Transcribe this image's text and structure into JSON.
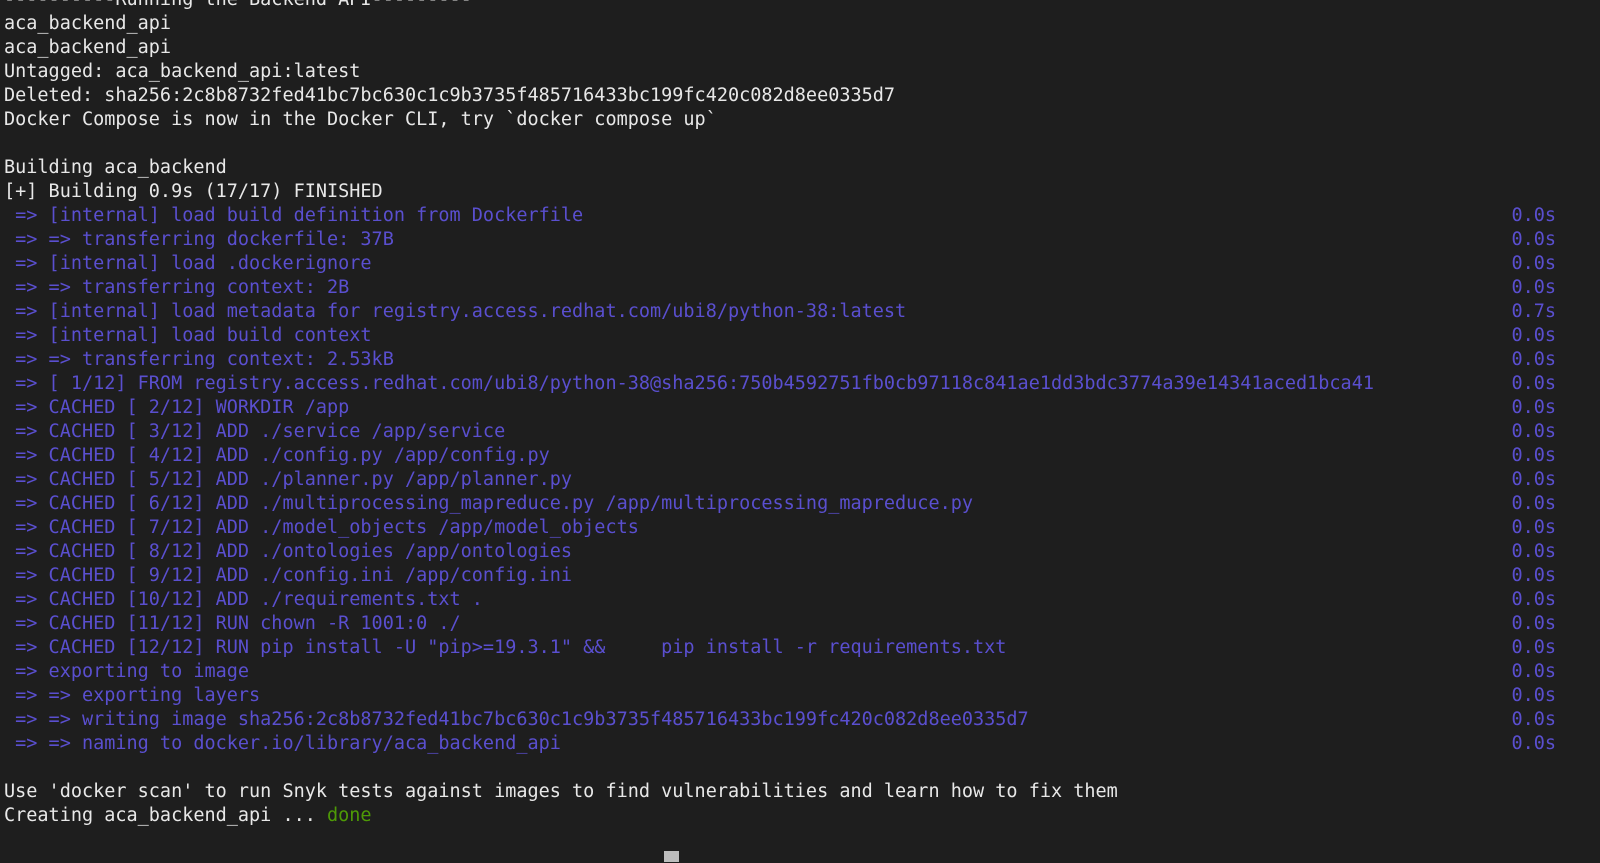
{
  "terminal": {
    "title": "Running the Backend API",
    "colors": {
      "background": "#1e1e1e",
      "foreground": "#e8e8e8",
      "buildkit_step": "#5a4fcf",
      "success": "#4e9a06",
      "cursor": "#bdbdbd"
    },
    "header_lines": [
      {
        "text": "----------Running the Backend API---------",
        "color": "white"
      },
      {
        "text": "aca_backend_api",
        "color": "white"
      },
      {
        "text": "aca_backend_api",
        "color": "white"
      },
      {
        "text": "Untagged: aca_backend_api:latest",
        "color": "white"
      },
      {
        "text": "Deleted: sha256:2c8b8732fed41bc7bc630c1c9b3735f485716433bc199fc420c082d8ee0335d7",
        "color": "white"
      },
      {
        "text": "Docker Compose is now in the Docker CLI, try `docker compose up`",
        "color": "white"
      },
      {
        "text": "",
        "color": "white"
      },
      {
        "text": "Building aca_backend",
        "color": "white"
      },
      {
        "text": "[+] Building 0.9s (17/17) FINISHED",
        "color": "white"
      }
    ],
    "build_steps": [
      {
        "text": " => [internal] load build definition from Dockerfile",
        "duration": "0.0s"
      },
      {
        "text": " => => transferring dockerfile: 37B",
        "duration": "0.0s"
      },
      {
        "text": " => [internal] load .dockerignore",
        "duration": "0.0s"
      },
      {
        "text": " => => transferring context: 2B",
        "duration": "0.0s"
      },
      {
        "text": " => [internal] load metadata for registry.access.redhat.com/ubi8/python-38:latest",
        "duration": "0.7s"
      },
      {
        "text": " => [internal] load build context",
        "duration": "0.0s"
      },
      {
        "text": " => => transferring context: 2.53kB",
        "duration": "0.0s"
      },
      {
        "text": " => [ 1/12] FROM registry.access.redhat.com/ubi8/python-38@sha256:750b4592751fb0cb97118c841ae1dd3bdc3774a39e14341aced1bca41",
        "duration": "0.0s"
      },
      {
        "text": " => CACHED [ 2/12] WORKDIR /app",
        "duration": "0.0s"
      },
      {
        "text": " => CACHED [ 3/12] ADD ./service /app/service",
        "duration": "0.0s"
      },
      {
        "text": " => CACHED [ 4/12] ADD ./config.py /app/config.py",
        "duration": "0.0s"
      },
      {
        "text": " => CACHED [ 5/12] ADD ./planner.py /app/planner.py",
        "duration": "0.0s"
      },
      {
        "text": " => CACHED [ 6/12] ADD ./multiprocessing_mapreduce.py /app/multiprocessing_mapreduce.py",
        "duration": "0.0s"
      },
      {
        "text": " => CACHED [ 7/12] ADD ./model_objects /app/model_objects",
        "duration": "0.0s"
      },
      {
        "text": " => CACHED [ 8/12] ADD ./ontologies /app/ontologies",
        "duration": "0.0s"
      },
      {
        "text": " => CACHED [ 9/12] ADD ./config.ini /app/config.ini",
        "duration": "0.0s"
      },
      {
        "text": " => CACHED [10/12] ADD ./requirements.txt .",
        "duration": "0.0s"
      },
      {
        "text": " => CACHED [11/12] RUN chown -R 1001:0 ./",
        "duration": "0.0s"
      },
      {
        "text": " => CACHED [12/12] RUN pip install -U \"pip>=19.3.1\" &&     pip install -r requirements.txt",
        "duration": "0.0s"
      },
      {
        "text": " => exporting to image",
        "duration": "0.0s"
      },
      {
        "text": " => => exporting layers",
        "duration": "0.0s"
      },
      {
        "text": " => => writing image sha256:2c8b8732fed41bc7bc630c1c9b3735f485716433bc199fc420c082d8ee0335d7",
        "duration": "0.0s"
      },
      {
        "text": " => => naming to docker.io/library/aca_backend_api",
        "duration": "0.0s"
      }
    ],
    "footer_lines": [
      {
        "text": "",
        "color": "white"
      },
      {
        "text": "Use 'docker scan' to run Snyk tests against images to find vulnerabilities and learn how to fix them",
        "color": "white"
      },
      {
        "prefix": "Creating aca_backend_api ... ",
        "status": "done",
        "color": "white",
        "status_color": "green"
      }
    ],
    "cursor": {
      "visible": true,
      "shape": "block"
    }
  }
}
